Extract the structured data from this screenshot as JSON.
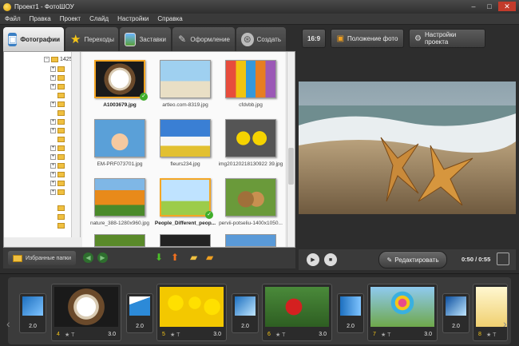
{
  "window": {
    "title": "Проект1 - ФотоШОУ",
    "minimize": "–",
    "maximize": "□",
    "close": "✕"
  },
  "menu": [
    "Файл",
    "Правка",
    "Проект",
    "Слайд",
    "Настройки",
    "Справка"
  ],
  "tabs": [
    {
      "label": "Фотографии",
      "icon": "photos-icon"
    },
    {
      "label": "Переходы",
      "icon": "star-icon"
    },
    {
      "label": "Заставки",
      "icon": "intro-icon"
    },
    {
      "label": "Оформление",
      "icon": "design-icon"
    },
    {
      "label": "Создать",
      "icon": "film-reel-icon"
    }
  ],
  "tree": {
    "root_label": "1425"
  },
  "thumbnails": [
    {
      "caption": "A1003679.jpg",
      "bold": true,
      "checked": true
    },
    {
      "caption": "artleo.com-8319.jpg"
    },
    {
      "caption": "cfdvbb.jpg"
    },
    {
      "caption": "EM-PRF073701.jpg"
    },
    {
      "caption": "fleurs234.jpg"
    },
    {
      "caption": "img20120218130922 39.jpg"
    },
    {
      "caption": "nature_388-1280x960.jpg"
    },
    {
      "caption": "People_Different_peop...",
      "bold": true,
      "checked": true
    },
    {
      "caption": "pervii-potseliu-1400x1050..."
    }
  ],
  "bottom_bar": {
    "favorites_label": "Избранные папки"
  },
  "right_toolbar": {
    "aspect": "16:9",
    "photo_position": "Положение фото",
    "project_settings": "Настройки проекта"
  },
  "player": {
    "edit_label": "Редактировать",
    "time": "0:50 / 0:55"
  },
  "timeline": {
    "slides": [
      {
        "number": "4",
        "duration": "3.0"
      },
      {
        "number": "5",
        "duration": "3.0"
      },
      {
        "number": "6",
        "duration": "3.0"
      },
      {
        "number": "7",
        "duration": "3.0"
      },
      {
        "number": "8",
        "duration": "3.0"
      }
    ],
    "transitions": [
      "2.0",
      "2.0",
      "2.0",
      "2.0",
      "2.0"
    ],
    "first_transition": "2.0",
    "slide_icons": "★ T"
  }
}
